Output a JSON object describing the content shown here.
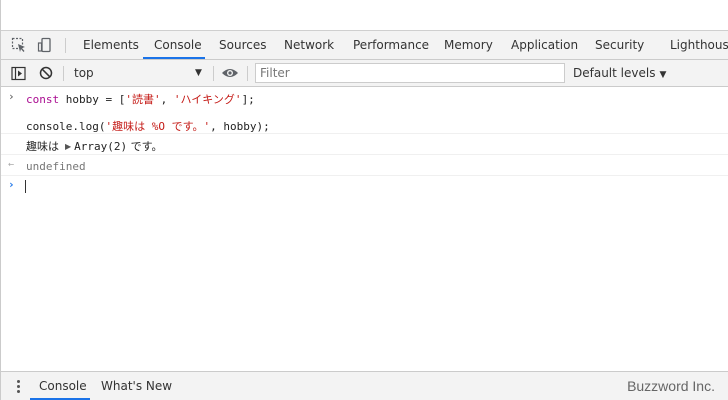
{
  "tabs": [
    "Elements",
    "Console",
    "Sources",
    "Network",
    "Performance",
    "Memory",
    "Application",
    "Security",
    "Lighthouse"
  ],
  "active_tab": "Console",
  "toolbar": {
    "context": "top",
    "filter_placeholder": "Filter",
    "levels": "Default levels"
  },
  "console": {
    "line1": {
      "kw": "const",
      "rest": " hobby = [",
      "str1": "'読書'",
      "comma": ", ",
      "str2": "'ハイキング'",
      "end": "];"
    },
    "line2": {
      "pre": "console.log(",
      "str": "'趣味は %O です。'",
      "post": ", hobby);"
    },
    "output": {
      "lead": "趣味は",
      "array": "Array(2)",
      "trail": "です。"
    },
    "result": "undefined"
  },
  "drawer": {
    "tabs": [
      "Console",
      "What's New"
    ]
  },
  "watermark": "Buzzword Inc.",
  "colors": {
    "accent": "#1a73e8",
    "keyword": "#aa0d91",
    "string": "#c41a16"
  }
}
